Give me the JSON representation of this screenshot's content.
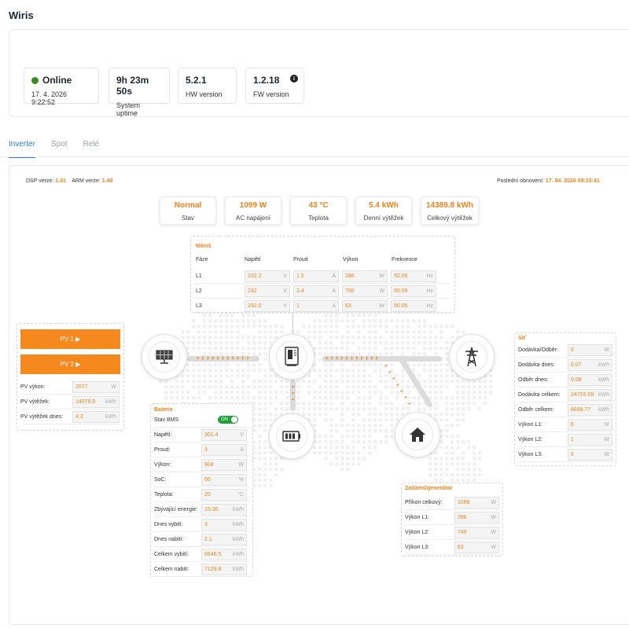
{
  "app": {
    "title": "Wiris"
  },
  "status": {
    "online_label": "Online",
    "online_time": "17. 4. 2026 9:22:52",
    "uptime": "9h 23m 50s",
    "uptime_label": "System uptime",
    "hw_version": "5.2.1",
    "hw_label": "HW version",
    "fw_version": "1.2.18",
    "fw_label": "FW version",
    "info_glyph": "i"
  },
  "tabs": [
    {
      "label": "Inverter",
      "active": true
    },
    {
      "label": "Spot",
      "active": false
    },
    {
      "label": "Relé",
      "active": false
    }
  ],
  "versions": {
    "dsp_label": "DSP verze:",
    "dsp_value": "1.41",
    "arm_label": "ARM verze:",
    "arm_value": "1.40",
    "updated_label": "Poslední obnovení:",
    "updated_value": "17. 04. 2026 09:23:41"
  },
  "kpis": [
    {
      "value": "Normal",
      "label": "Stav"
    },
    {
      "value": "1099 W",
      "label": "AC napájení"
    },
    {
      "value": "43 °C",
      "label": "Teplota"
    },
    {
      "value": "5.4 kWh",
      "label": "Denní výtěžek"
    },
    {
      "value": "14389.8 kWh",
      "label": "Celkový výtěžek"
    }
  ],
  "inverter": {
    "title": "Měnič",
    "headers": [
      "Fáze",
      "Napětí",
      "Proud",
      "Výkon",
      "Frekvence"
    ],
    "rows": [
      {
        "phase": "L1",
        "voltage": "232.2",
        "current": "1.5",
        "power": "286",
        "freq": "50.05"
      },
      {
        "phase": "L2",
        "voltage": "232",
        "current": "3.4",
        "power": "750",
        "freq": "50.06"
      },
      {
        "phase": "L3",
        "voltage": "232.5",
        "current": "1",
        "power": "63",
        "freq": "50.05"
      }
    ],
    "units": {
      "v": "V",
      "a": "A",
      "w": "W",
      "hz": "Hz"
    }
  },
  "pv": {
    "pv1": "PV 1 ▶",
    "pv2": "PV 2 ▶",
    "rows": [
      {
        "label": "PV výkon:",
        "value": "2077",
        "unit": "W"
      },
      {
        "label": "PV výtěžek:",
        "value": "14078.9",
        "unit": "kWh"
      },
      {
        "label": "PV výtěžek dnes:",
        "value": "4.3",
        "unit": "kWh"
      }
    ]
  },
  "battery": {
    "title": "Baterie",
    "bms_label": "Stav BMS",
    "bms_state": "ON",
    "rows": [
      {
        "label": "Napětí:",
        "value": "301.4",
        "unit": "V"
      },
      {
        "label": "Proud:",
        "value": "3",
        "unit": "A"
      },
      {
        "label": "Výkon:",
        "value": "904",
        "unit": "W"
      },
      {
        "label": "SoC:",
        "value": "66",
        "unit": "%"
      },
      {
        "label": "Teplota:",
        "value": "20",
        "unit": "°C"
      },
      {
        "label": "Zbývající energie:",
        "value": "15.36",
        "unit": "kWh"
      },
      {
        "label": "Dnes vybití:",
        "value": "3",
        "unit": "kWh"
      },
      {
        "label": "Dnes nabití:",
        "value": "2.1",
        "unit": "kWh"
      },
      {
        "label": "Celkem vybití:",
        "value": "6646.5",
        "unit": "kWh"
      },
      {
        "label": "Celkem nabití:",
        "value": "7129.8",
        "unit": "kWh"
      }
    ]
  },
  "grid": {
    "title": "Síť",
    "rows": [
      {
        "label": "Dodávka/Odběr:",
        "value": "0",
        "unit": "W"
      },
      {
        "label": "Dodávka dnes:",
        "value": "0.07",
        "unit": "kWh"
      },
      {
        "label": "Odběr dnes:",
        "value": "0.08",
        "unit": "kWh"
      },
      {
        "label": "Dodávka celkem:",
        "value": "24755.59",
        "unit": "kWh"
      },
      {
        "label": "Odběr celkem:",
        "value": "8698.77",
        "unit": "kWh"
      },
      {
        "label": "Výkon L1:",
        "value": "0",
        "unit": "W"
      },
      {
        "label": "Výkon L2:",
        "value": "1",
        "unit": "W"
      },
      {
        "label": "Výkon L3:",
        "value": "0",
        "unit": "W"
      }
    ]
  },
  "load": {
    "title": "Zatížení/generátor",
    "rows": [
      {
        "label": "Příkon celkový:",
        "value": "1098",
        "unit": "W"
      },
      {
        "label": "Výkon L1:",
        "value": "286",
        "unit": "W"
      },
      {
        "label": "Výkon L2:",
        "value": "749",
        "unit": "W"
      },
      {
        "label": "Výkon L3:",
        "value": "63",
        "unit": "W"
      }
    ]
  },
  "flow_glyph": "›"
}
